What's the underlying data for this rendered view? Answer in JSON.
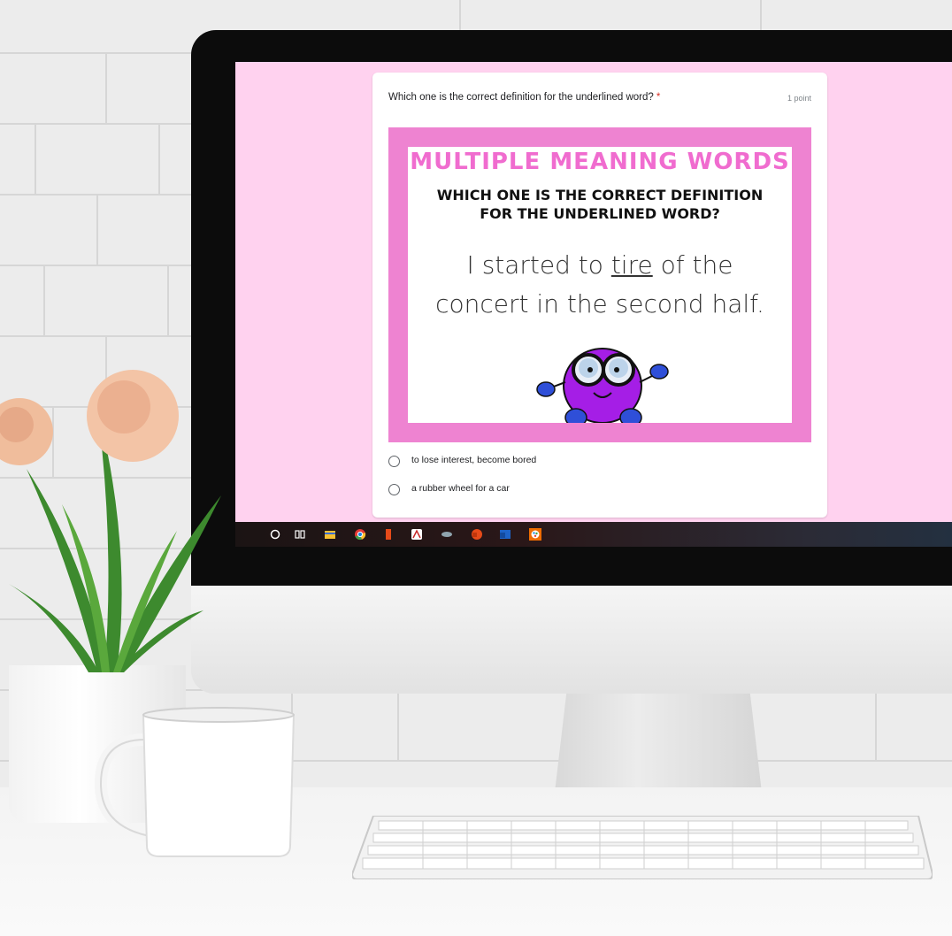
{
  "form": {
    "question": "Which one is the correct definition for the underlined word?",
    "required_marker": "*",
    "points": "1 point",
    "options": [
      {
        "label": "to lose interest, become bored",
        "selected": false
      },
      {
        "label": "a rubber wheel for a car",
        "selected": false
      }
    ]
  },
  "slide": {
    "title": "MULTIPLE MEANING WORDS",
    "subtitle_line1": "WHICH ONE IS THE CORRECT DEFINITION",
    "subtitle_line2": "FOR THE UNDERLINED WORD?",
    "sentence_pre": "I started to ",
    "sentence_word": "tire",
    "sentence_post": " of the",
    "sentence_line2": "concert in the second half."
  },
  "taskbar": {
    "icons": [
      "search-icon",
      "task-view-icon",
      "file-explorer-icon",
      "chrome-icon",
      "office-icon",
      "acrobat-icon",
      "stream-icon",
      "powerpoint-icon",
      "word-icon",
      "paint-icon"
    ]
  },
  "colors": {
    "screen_bg": "#ffd2ef",
    "slide_border": "#ee83d1",
    "slide_title": "#f06ccf",
    "required": "#d93025",
    "mascot_body": "#a51ee6",
    "mascot_hands": "#2f4fd8"
  }
}
